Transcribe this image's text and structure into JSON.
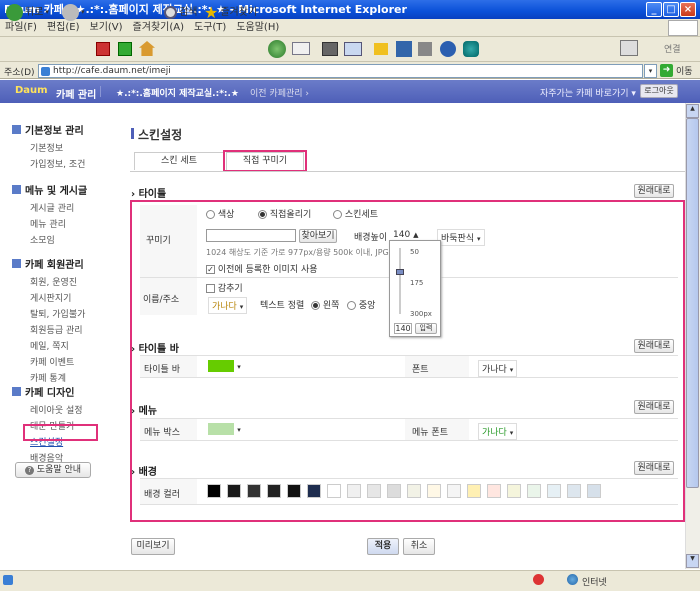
{
  "window": {
    "title": "Daum 카페 | ★.:*:.홈페이지 제작교실.:*:.★ - Microsoft Internet Explorer"
  },
  "menu": [
    "파일(F)",
    "편집(E)",
    "보기(V)",
    "즐겨찾기(A)",
    "도구(T)",
    "도움말(H)"
  ],
  "toolbar": {
    "back": "뒤로",
    "search": "검색",
    "favorites": "즐겨찾기",
    "link": "연결"
  },
  "address": {
    "label": "주소(D)",
    "url": "http://cafe.daum.net/imeji",
    "go": "이동"
  },
  "cafe_header": {
    "logo": "Daum",
    "admin": "카페 관리",
    "cafe_name": "★.:*:.홈페이지 제작교실.:*:.★",
    "prev_menu": "이전 카페관리",
    "quick": "자주가는 카페 바로가기",
    "logout": "로그아웃"
  },
  "sidebar": {
    "groups": [
      {
        "title": "기본정보 관리",
        "items": [
          "기본정보",
          "가입정보, 조건"
        ]
      },
      {
        "title": "메뉴 및 게시글",
        "items": [
          "게시글 관리",
          "메뉴 관리",
          "소모임"
        ]
      },
      {
        "title": "카페 회원관리",
        "items": [
          "회원, 운영진",
          "게시판지기",
          "탈퇴, 가입불가",
          "회원등급 관리",
          "메일, 쪽지",
          "카페 이벤트",
          "카페 통계"
        ]
      },
      {
        "title": "카페 디자인",
        "items": [
          "레이아웃 설정",
          "대문 만들기",
          "스킨설정",
          "배경음악"
        ]
      }
    ],
    "help": "도움말 안내"
  },
  "page": {
    "title": "스킨설정",
    "tabs": [
      "스킨 세트",
      "직접 꾸미기"
    ]
  },
  "title_section": {
    "heading": "타이틀",
    "reset": "원래대로",
    "decorate_label": "꾸미기",
    "radios": [
      "색상",
      "직접올리기",
      "스킨세트"
    ],
    "browse": "찾아보기",
    "bg_height_label": "배경높이",
    "bg_height": "140",
    "tile": "바둑판식",
    "hint": "1024 해상도 기준 가로 977px/용량 500k 이내, JPG,G",
    "hint_size": "977px",
    "hint_cap": "500k",
    "use_prev": "이전에 등록한 이미지 사용",
    "name_label": "이름/주소",
    "hide": "감추기",
    "font": "가나다",
    "align_label": "텍스트 정렬",
    "align": [
      "왼쪽",
      "중앙"
    ]
  },
  "slider": {
    "marks": [
      "50",
      "175",
      "300px"
    ],
    "value": "140",
    "enter": "입력"
  },
  "titlebar_section": {
    "heading": "타이틀 바",
    "reset": "원래대로",
    "label": "타이틀 바",
    "font_label": "폰트",
    "font": "가나다"
  },
  "menu_section": {
    "heading": "메뉴",
    "reset": "원래대로",
    "label": "메뉴 박스",
    "font_label": "메뉴 폰트",
    "font": "가나다"
  },
  "bg_section": {
    "heading": "배경",
    "reset": "원래대로",
    "label": "배경 컬러"
  },
  "swatches": [
    "#000000",
    "#1a1a1a",
    "#333333",
    "#222222",
    "#111111",
    "#1e2d4f",
    "#ffffff",
    "#f0f0f0",
    "#e6e6e6",
    "#dcdcdc",
    "#f2f2e6",
    "#fff8e6",
    "#f5f5f5",
    "#fff0b3",
    "#ffe6e0",
    "#f5f5dc",
    "#eaf5ea",
    "#e6f0f5",
    "#dde6ee",
    "#d6e0ea"
  ],
  "colors": {
    "titlebar": "#66cc00",
    "menubox": "#b8e0a8",
    "accent": "#e0307a"
  },
  "footer": {
    "preview": "미리보기",
    "apply": "적용",
    "cancel": "취소"
  },
  "status": {
    "zone": "인터넷"
  }
}
